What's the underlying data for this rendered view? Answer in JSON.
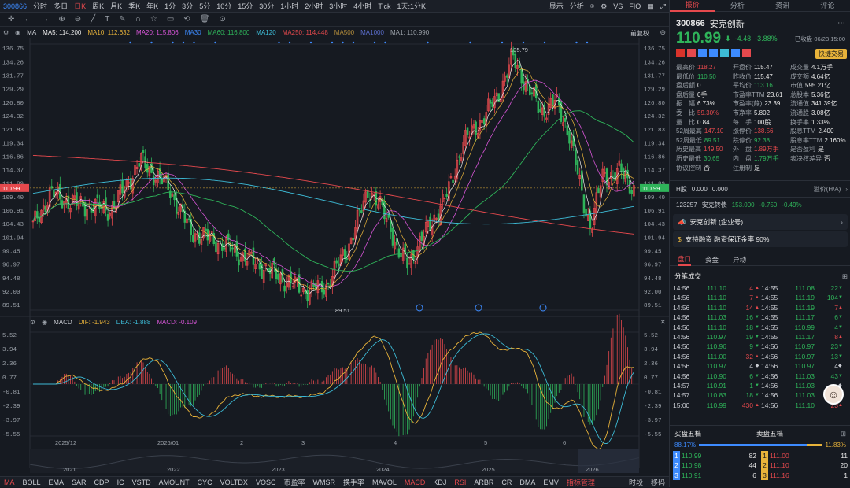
{
  "topbar": {
    "code": "300866",
    "periods": [
      "分时",
      "多日",
      "日K",
      "周K",
      "月K",
      "季K",
      "年K",
      "1分",
      "3分",
      "5分",
      "10分",
      "15分",
      "30分",
      "1小时",
      "2小时",
      "3小时",
      "4小时",
      "Tick",
      "1天:1分K"
    ],
    "active_period": "日K",
    "right": [
      "显示",
      "分析",
      "VS",
      "FIO"
    ]
  },
  "ma_legend": {
    "label": "MA",
    "items": [
      {
        "text": "MA5: 114.200",
        "color": "#e8e8e8"
      },
      {
        "text": "MA10: 112.632",
        "color": "#e8b33a"
      },
      {
        "text": "MA20: 115.806",
        "color": "#d655d6"
      },
      {
        "text": "MA30",
        "color": "#3d8bff"
      },
      {
        "text": "MA60: 116.800",
        "color": "#2fb45a"
      },
      {
        "text": "MA120",
        "color": "#3dbbd6"
      },
      {
        "text": "MA250: 114.448",
        "color": "#e5494d"
      },
      {
        "text": "MA500",
        "color": "#b08a3a"
      },
      {
        "text": "MA1000",
        "color": "#5a6cc9"
      },
      {
        "text": "MA1: 110.990",
        "color": "#9aa0a8"
      }
    ],
    "adjust": "前复权"
  },
  "price_axis": [
    "136.75",
    "134.26",
    "131.77",
    "129.29",
    "126.80",
    "124.32",
    "121.83",
    "119.34",
    "116.86",
    "114.37",
    "111.89",
    "109.40",
    "106.91",
    "104.43",
    "101.94",
    "99.45",
    "96.97",
    "94.48",
    "92.00",
    "89.51"
  ],
  "current_price_tag": "110.99",
  "annotations": {
    "high": "135.79",
    "low": "89.51"
  },
  "macd_legend": {
    "label": "MACD",
    "dif": "DIF: -1.943",
    "dea": "DEA: -1.888",
    "macd": "MACD: -0.109"
  },
  "macd_axis": [
    "5.52",
    "3.94",
    "2.36",
    "0.77",
    "-0.81",
    "-2.39",
    "-3.97",
    "-5.55"
  ],
  "time_axis": [
    "2025/12",
    "2026/01",
    "2",
    "3",
    "4",
    "5",
    "6"
  ],
  "overview_years": [
    "2021",
    "2022",
    "2023",
    "2024",
    "2025",
    "2026"
  ],
  "bottombar": {
    "indicators": [
      "MA",
      "BOLL",
      "EMA",
      "SAR",
      "CDP",
      "IC",
      "VSTD",
      "AMOUNT",
      "CYC",
      "VOLTDX",
      "VOSC",
      "市盈率",
      "WMSR",
      "换手率",
      "MAVOL",
      "MACD",
      "KDJ",
      "RSI",
      "ARBR",
      "CR",
      "DMA",
      "EMV"
    ],
    "active": [
      "MA",
      "MACD",
      "RSI"
    ],
    "manage": "指标管理",
    "right": [
      "时段",
      "移码"
    ]
  },
  "right_tabs": [
    "报价",
    "分析",
    "资讯",
    "评论"
  ],
  "stock": {
    "code": "300866",
    "name": "安克创新",
    "price": "110.99",
    "change": "-4.48",
    "pct": "-3.88%",
    "date": "已收盘 06/23 15:00",
    "quick_trade": "快捷交易"
  },
  "quote_left": [
    {
      "k": "最高价",
      "v": "118.27",
      "c": "red"
    },
    {
      "k": "最低价",
      "v": "110.50",
      "c": "grn"
    },
    {
      "k": "盘后额",
      "v": "0",
      "c": "wht"
    },
    {
      "k": "盘后量",
      "v": "0手",
      "c": "wht"
    },
    {
      "k": "振　幅",
      "v": "6.73%",
      "c": "wht"
    },
    {
      "k": "委　比",
      "v": "59.30%",
      "c": "red"
    },
    {
      "k": "量　比",
      "v": "0.84",
      "c": "wht"
    },
    {
      "k": "52周最高",
      "v": "147.10",
      "c": "red"
    },
    {
      "k": "52周最低",
      "v": "89.51",
      "c": "grn"
    },
    {
      "k": "历史最高",
      "v": "149.50",
      "c": "red"
    },
    {
      "k": "历史最低",
      "v": "30.65",
      "c": "grn"
    },
    {
      "k": "协议控制",
      "v": "否",
      "c": "wht"
    }
  ],
  "quote_mid": [
    {
      "k": "开盘价",
      "v": "115.47",
      "c": "wht"
    },
    {
      "k": "昨收价",
      "v": "115.47",
      "c": "wht"
    },
    {
      "k": "平均价",
      "v": "113.16",
      "c": "grn"
    },
    {
      "k": "市盈率TTM",
      "v": "23.61",
      "c": "wht"
    },
    {
      "k": "市盈率(静)",
      "v": "23.39",
      "c": "wht"
    },
    {
      "k": "市净率",
      "v": "5.802",
      "c": "wht"
    },
    {
      "k": "每　手",
      "v": "100股",
      "c": "wht"
    },
    {
      "k": "涨停价",
      "v": "138.56",
      "c": "red"
    },
    {
      "k": "跌停价",
      "v": "92.38",
      "c": "grn"
    },
    {
      "k": "外　盘",
      "v": "1.89万手",
      "c": "red"
    },
    {
      "k": "内　盘",
      "v": "1.79万手",
      "c": "grn"
    },
    {
      "k": "注册制",
      "v": "是",
      "c": "wht"
    }
  ],
  "quote_right": [
    {
      "k": "成交量",
      "v": "4.1万手",
      "c": "wht"
    },
    {
      "k": "成交额",
      "v": "4.64亿",
      "c": "wht"
    },
    {
      "k": "市值",
      "v": "595.21亿",
      "c": "wht"
    },
    {
      "k": "总股本",
      "v": "5.36亿",
      "c": "wht"
    },
    {
      "k": "流通值",
      "v": "341.39亿",
      "c": "wht"
    },
    {
      "k": "流通股",
      "v": "3.08亿",
      "c": "wht"
    },
    {
      "k": "换手率",
      "v": "1.33%",
      "c": "wht"
    },
    {
      "k": "股息TTM",
      "v": "2.400",
      "c": "wht"
    },
    {
      "k": "股息率TTM",
      "v": "2.160%",
      "c": "wht"
    },
    {
      "k": "是否盈利",
      "v": "是",
      "c": "wht"
    },
    {
      "k": "表决权差异",
      "v": "否",
      "c": "wht"
    }
  ],
  "h_share": {
    "label": "H股",
    "v1": "0.000",
    "v2": "0.000",
    "ah": "溢价(H/A)"
  },
  "bond": {
    "code": "123257",
    "name": "安克转债",
    "price": "153.000",
    "chg": "-0.750",
    "pct": "-0.49%"
  },
  "notice1": "安克创新 (企业号)",
  "notice2": "支持融资 融资保证金率 90%",
  "sub_tabs": [
    "盘口",
    "资金",
    "异动"
  ],
  "trades_title": "分笔成交",
  "trades": [
    {
      "t": "14:56",
      "p": "111.10",
      "v": "4",
      "d": "up",
      "t2": "14:55",
      "p2": "111.08",
      "v2": "22",
      "d2": "dn"
    },
    {
      "t": "14:56",
      "p": "111.10",
      "v": "7",
      "d": "up",
      "t2": "14:55",
      "p2": "111.19",
      "v2": "104",
      "d2": "dn"
    },
    {
      "t": "14:56",
      "p": "111.10",
      "v": "14",
      "d": "up",
      "t2": "14:55",
      "p2": "111.19",
      "v2": "7",
      "d2": "up"
    },
    {
      "t": "14:56",
      "p": "111.03",
      "v": "16",
      "d": "dn",
      "t2": "14:55",
      "p2": "111.17",
      "v2": "6",
      "d2": "dn"
    },
    {
      "t": "14:56",
      "p": "111.10",
      "v": "18",
      "d": "dn",
      "t2": "14:55",
      "p2": "110.99",
      "v2": "4",
      "d2": "dn"
    },
    {
      "t": "14:56",
      "p": "110.97",
      "v": "19",
      "d": "dn",
      "t2": "14:55",
      "p2": "111.17",
      "v2": "8",
      "d2": "up"
    },
    {
      "t": "14:56",
      "p": "110.96",
      "v": "9",
      "d": "dn",
      "t2": "14:56",
      "p2": "110.97",
      "v2": "23",
      "d2": "dn"
    },
    {
      "t": "14:56",
      "p": "111.00",
      "v": "32",
      "d": "up",
      "t2": "14:56",
      "p2": "110.97",
      "v2": "13",
      "d2": "dn"
    },
    {
      "t": "14:56",
      "p": "110.97",
      "v": "4",
      "d": "n",
      "t2": "14:56",
      "p2": "110.97",
      "v2": "4",
      "d2": "n"
    },
    {
      "t": "14:56",
      "p": "110.90",
      "v": "6",
      "d": "dn",
      "t2": "14:56",
      "p2": "111.03",
      "v2": "43",
      "d2": "dn"
    },
    {
      "t": "14:57",
      "p": "110.91",
      "v": "1",
      "d": "dn",
      "t2": "14:56",
      "p2": "111.03",
      "v2": "",
      "d2": "n"
    },
    {
      "t": "14:57",
      "p": "110.83",
      "v": "18",
      "d": "dn",
      "t2": "14:56",
      "p2": "111.03",
      "v2": "",
      "d2": "n"
    },
    {
      "t": "15:00",
      "p": "110.99",
      "v": "430",
      "d": "up",
      "t2": "14:56",
      "p2": "111.10",
      "v2": "23",
      "d2": "up"
    }
  ],
  "order_book": {
    "buy_title": "买盘五档",
    "sell_title": "卖盘五档",
    "buy_pct": "88.17%",
    "sell_pct": "11.83%",
    "buy_share": 0.8817,
    "rows": [
      {
        "n": "1",
        "bp": "110.99",
        "bv": "82",
        "sp": "111.00",
        "sv": "11"
      },
      {
        "n": "2",
        "bp": "110.98",
        "bv": "44",
        "sp": "111.10",
        "sv": "20"
      },
      {
        "n": "3",
        "bp": "110.91",
        "bv": "6",
        "sp": "111.16",
        "sv": "1"
      }
    ]
  }
}
